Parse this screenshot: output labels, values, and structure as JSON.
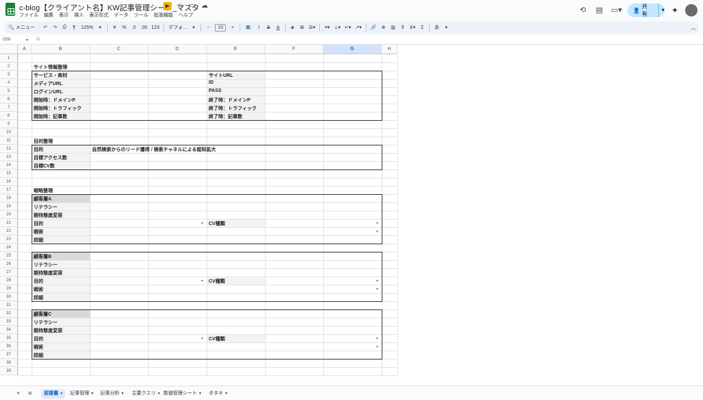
{
  "app": {
    "title": "c-blog【クライアント名】KW記事管理シート_マスタ",
    "menus": [
      "ファイル",
      "編集",
      "表示",
      "挿入",
      "表示形式",
      "データ",
      "ツール",
      "拡張機能",
      "ヘルプ"
    ],
    "share_label": "共有",
    "icons": {
      "history": "history-icon",
      "comment": "comment-icon",
      "meet": "video-icon",
      "gemini": "sparkle-icon"
    }
  },
  "toolbar": {
    "search_label": "メニュー",
    "zoom": "125%",
    "currency": "¥",
    "percent": "%",
    "dec_dec": ".0",
    "dec_inc": ".00",
    "num_format": "123",
    "font": "デフォ...",
    "minus": "−",
    "font_size": "10",
    "plus": "+",
    "bold": "B",
    "italic": "I",
    "strike": "S",
    "text_color": "A",
    "ime": "あ"
  },
  "formula_bar": {
    "cell_ref": "G58",
    "fx": "fx",
    "caret": "▾"
  },
  "columns": [
    "A",
    "B",
    "C",
    "D",
    "E",
    "F",
    "G",
    "H"
  ],
  "selected_column": "G",
  "rows": [
    "1",
    "2",
    "3",
    "4",
    "5",
    "6",
    "7",
    "8",
    "9",
    "10",
    "11",
    "12",
    "13",
    "14",
    "15",
    "16",
    "17",
    "18",
    "19",
    "20",
    "21",
    "22",
    "23",
    "24",
    "25",
    "26",
    "27",
    "28",
    "29",
    "30",
    "31",
    "32",
    "33",
    "34",
    "35",
    "36",
    "37",
    "38",
    "39"
  ],
  "sheet": {
    "site_section_title": "サイト情報整理",
    "site_rows_left": [
      "サービス・商材",
      "メディアURL",
      "ログインURL",
      "開始時：ドメインP",
      "開始時：トラフィック",
      "開始時：記事数"
    ],
    "site_rows_right": [
      "サイトURL",
      "ID",
      "PASS",
      "終了時：ドメインP",
      "終了時：トラフィック",
      "終了時：記事数"
    ],
    "goal_section_title": "目的整理",
    "goal_rows": [
      "目的",
      "目標アクセス数",
      "目標CV数"
    ],
    "goal_value": "自然検索からのリード獲得 / 検索チャネルによる認知拡大",
    "strategy_section_title": "戦略整理",
    "segments": [
      {
        "name": "顧客層A",
        "rows": [
          "リテラシー",
          "期待態度変容",
          "目的",
          "戦術",
          "詳細"
        ],
        "cv_label": "CV種類"
      },
      {
        "name": "顧客層B",
        "rows": [
          "リテラシー",
          "期待態度変容",
          "目的",
          "戦術",
          "詳細"
        ],
        "cv_label": "CV種類"
      },
      {
        "name": "顧客層C",
        "rows": [
          "リテラシー",
          "期待態度変容",
          "目的",
          "戦術",
          "詳細"
        ],
        "cv_label": "CV種類"
      }
    ]
  },
  "tabs": [
    {
      "label": "前提書",
      "active": true
    },
    {
      "label": "記事管理",
      "active": false
    },
    {
      "label": "記事分析",
      "active": false
    },
    {
      "label": "主要クエリ",
      "active": false
    },
    {
      "label": "数値管理シート",
      "active": false
    },
    {
      "label": "タタキ",
      "active": false
    }
  ]
}
